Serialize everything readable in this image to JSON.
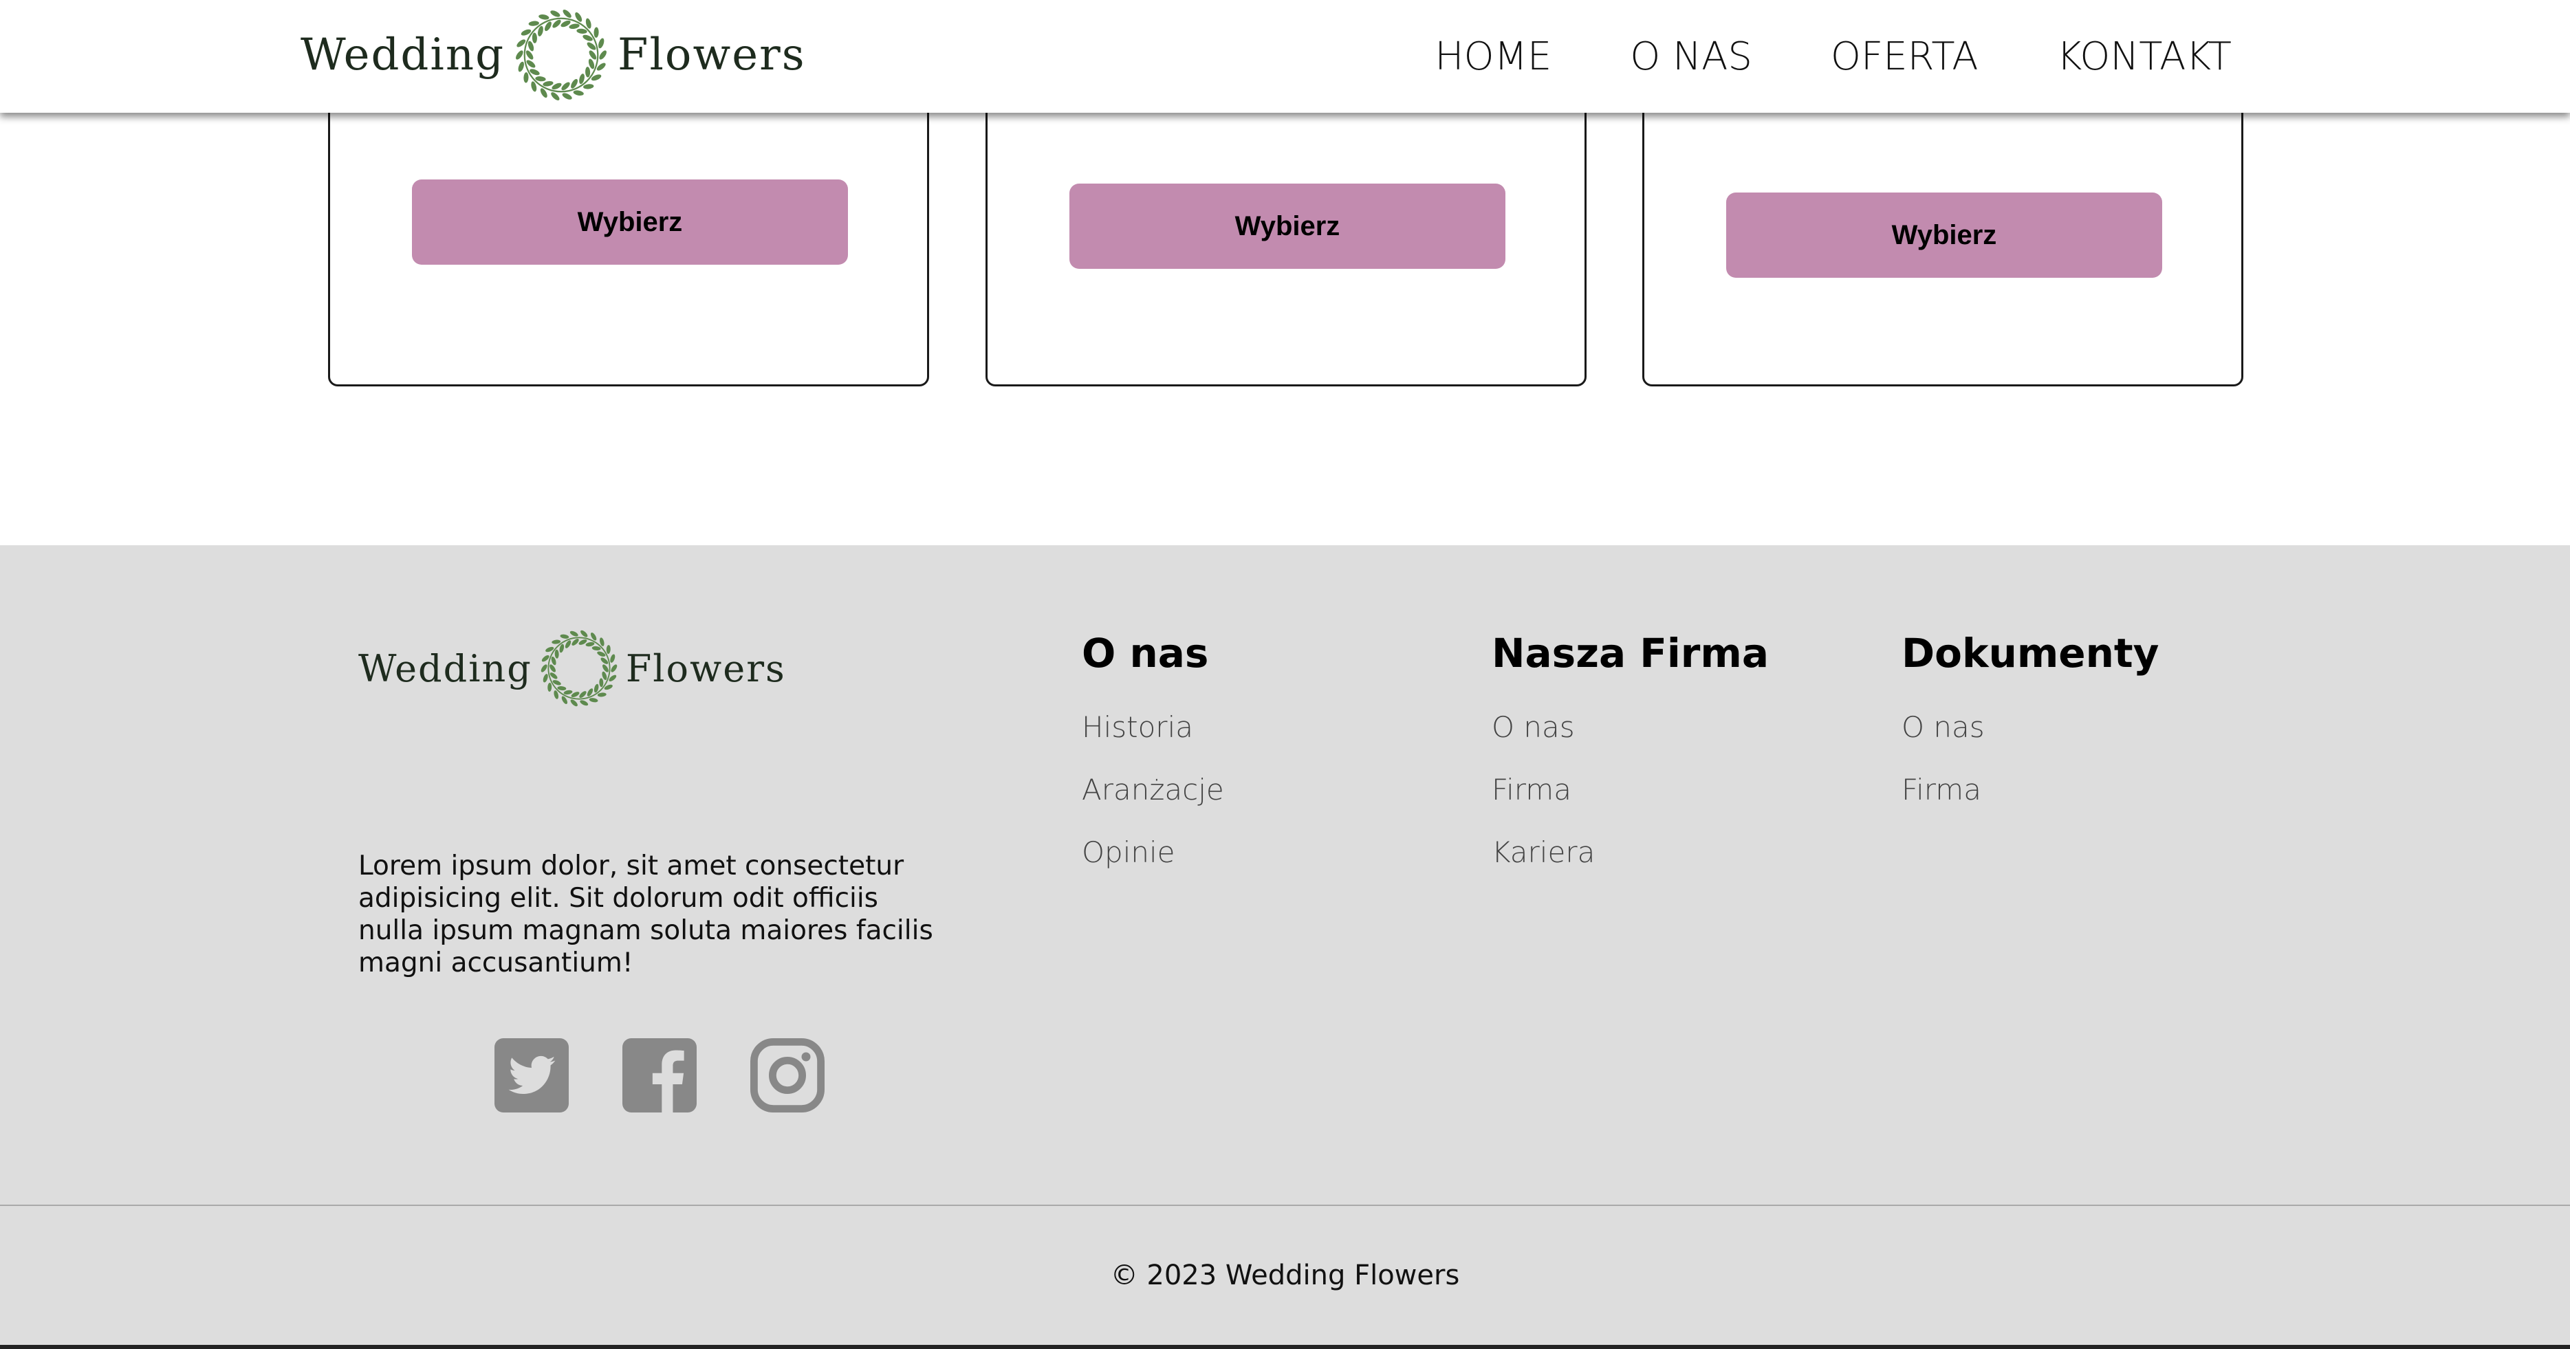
{
  "brand": {
    "word_left": "Wedding",
    "word_right": "Flowers",
    "wreath_icon": "wreath-icon",
    "wreath_color": "#5e8a4e"
  },
  "nav": {
    "items": [
      "HOME",
      "O NAS",
      "OFERTA",
      "KONTAKT"
    ]
  },
  "cards": [
    {
      "button_label": "Wybierz"
    },
    {
      "button_label": "Wybierz"
    },
    {
      "button_label": "Wybierz"
    }
  ],
  "colors": {
    "accent": "#c28baf",
    "footer_bg": "#dddddd",
    "social_icon": "#888888"
  },
  "footer": {
    "description": "Lorem ipsum dolor, sit amet consectetur adipisicing elit. Sit dolorum odit officiis nulla ipsum magnam soluta maiores facilis magni accusantium!",
    "socials": [
      "twitter-icon",
      "facebook-icon",
      "instagram-icon"
    ],
    "columns": [
      {
        "title": "O nas",
        "links": [
          "Historia",
          "Aranżacje",
          "Opinie"
        ]
      },
      {
        "title": "Nasza Firma",
        "links": [
          "O nas",
          "Firma",
          "Kariera"
        ]
      },
      {
        "title": "Dokumenty",
        "links": [
          "O nas",
          "Firma"
        ]
      }
    ],
    "copyright": "© 2023 Wedding Flowers"
  }
}
